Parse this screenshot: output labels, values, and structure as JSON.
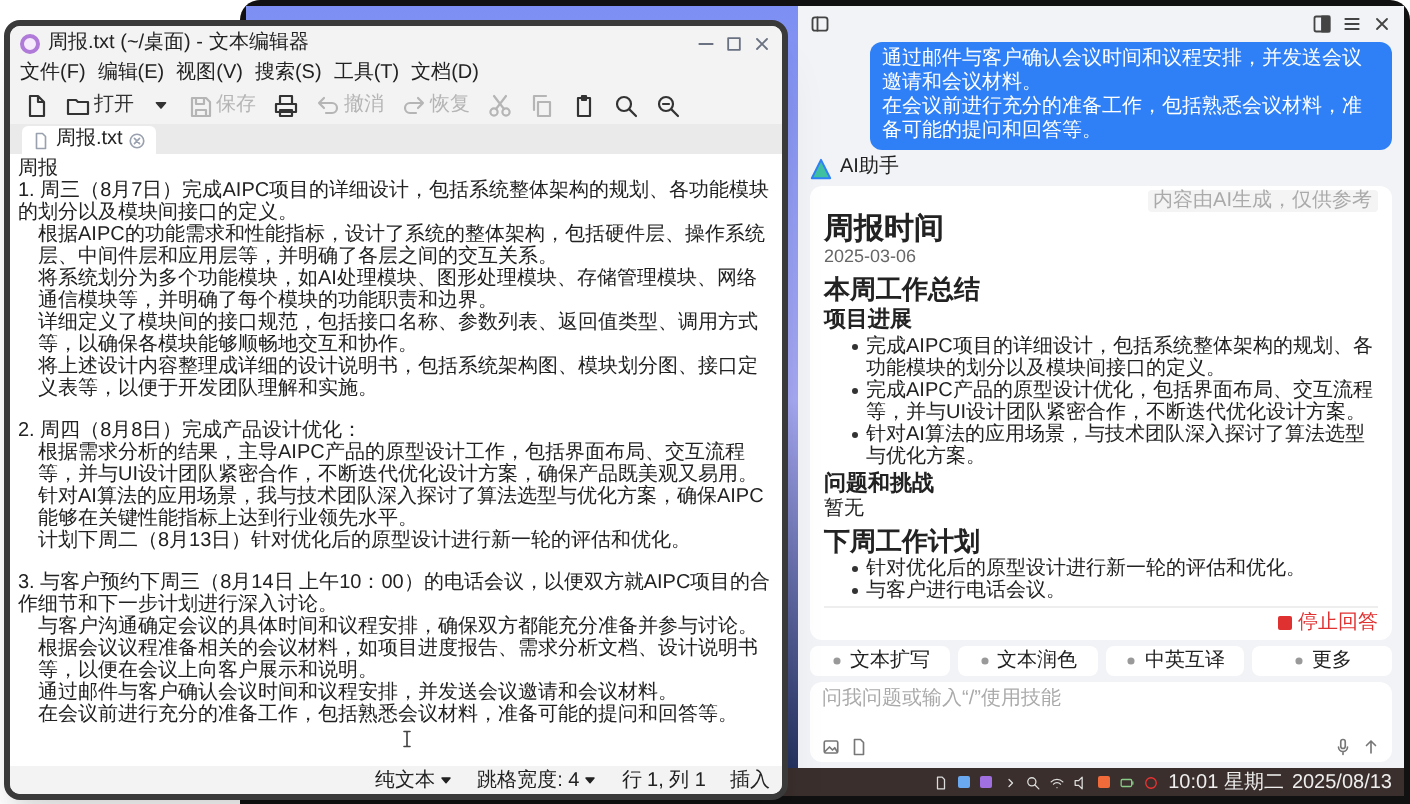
{
  "editor": {
    "title": "周报.txt (~/桌面) - 文本编辑器",
    "menu": [
      "文件(F)",
      "编辑(E)",
      "视图(V)",
      "搜索(S)",
      "工具(T)",
      "文档(D)"
    ],
    "toolbar": [
      {
        "kind": "new",
        "disabled": false
      },
      {
        "kind": "open",
        "label": "打开",
        "disabled": false
      },
      {
        "kind": "dropdown",
        "disabled": false
      },
      {
        "kind": "save",
        "label": "保存",
        "disabled": true
      },
      {
        "kind": "print",
        "disabled": false
      },
      {
        "kind": "undo",
        "label": "撤消",
        "disabled": true
      },
      {
        "kind": "redo",
        "label": "恢复",
        "disabled": true
      },
      {
        "kind": "cut",
        "disabled": true
      },
      {
        "kind": "copy",
        "disabled": true
      },
      {
        "kind": "paste",
        "disabled": false
      },
      {
        "kind": "search",
        "disabled": false
      },
      {
        "kind": "replace",
        "disabled": false
      }
    ],
    "tabs": [
      {
        "label": "周报.txt",
        "selected": true
      }
    ],
    "document": {
      "title": "周报",
      "sections": [
        {
          "heading": "1. 周三（8月7日）完成AIPC项目的详细设计，包括系统整体架构的规划、各功能模块的划分以及模块间接口的定义。",
          "lines": [
            "根据AIPC的功能需求和性能指标，设计了系统的整体架构，包括硬件层、操作系统层、中间件层和应用层等，并明确了各层之间的交互关系。",
            "将系统划分为多个功能模块，如AI处理模块、图形处理模块、存储管理模块、网络通信模块等，并明确了每个模块的功能职责和边界。",
            "详细定义了模块间的接口规范，包括接口名称、参数列表、返回值类型、调用方式等，以确保各模块能够顺畅地交互和协作。",
            "将上述设计内容整理成详细的设计说明书，包括系统架构图、模块划分图、接口定义表等，以便于开发团队理解和实施。"
          ]
        },
        {
          "heading": "2. 周四（8月8日）完成产品设计优化：",
          "lines": [
            "根据需求分析的结果，主导AIPC产品的原型设计工作，包括界面布局、交互流程等，并与UI设计团队紧密合作，不断迭代优化设计方案，确保产品既美观又易用。",
            "针对AI算法的应用场景，我与技术团队深入探讨了算法选型与优化方案，确保AIPC能够在关键性能指标上达到行业领先水平。",
            "计划下周二（8月13日）针对优化后的原型设计进行新一轮的评估和优化。"
          ]
        },
        {
          "heading": "3. 与客户预约下周三（8月14日 上午10：00）的电话会议，以便双方就AIPC项目的合作细节和下一步计划进行深入讨论。",
          "lines": [
            "与客户沟通确定会议的具体时间和议程安排，确保双方都能充分准备并参与讨论。",
            "根据会议议程准备相关的会议材料，如项目进度报告、需求分析文档、设计说明书等，以便在会议上向客户展示和说明。",
            "通过邮件与客户确认会议时间和议程安排，并发送会议邀请和会议材料。",
            "在会议前进行充分的准备工作，包括熟悉会议材料，准备可能的提问和回答等。"
          ]
        }
      ]
    },
    "status_bar": [
      {
        "kind": "dropdown",
        "label": "纯文本"
      },
      {
        "kind": "dropdown",
        "label": "跳格宽度: 4"
      },
      {
        "kind": "text",
        "label": "行 1, 列 1"
      },
      {
        "kind": "text",
        "label": "插入"
      }
    ]
  },
  "assistant": {
    "user_message": [
      "通过邮件与客户确认会议时间和议程安排，并发送会议邀请和会议材料。",
      "在会议前进行充分的准备工作，包括熟悉会议材料，准备可能的提问和回答等。"
    ],
    "name": "AI助手",
    "notice": "内容由AI生成，仅供参考",
    "report": {
      "title": "周报时间",
      "date": "2025-03-06",
      "sections": [
        {
          "heading": "本周工作总结",
          "subsections": [
            {
              "heading": "项目进展",
              "bullets": [
                "完成AIPC项目的详细设计，包括系统整体架构的规划、各功能模块的划分以及模块间接口的定义。",
                "完成AIPC产品的原型设计优化，包括界面布局、交互流程等，并与UI设计团队紧密合作，不断迭代优化设计方案。",
                "针对AI算法的应用场景，与技术团队深入探讨了算法选型与优化方案。"
              ]
            },
            {
              "heading": "问题和挑战",
              "text": "暂无"
            }
          ]
        },
        {
          "heading": "下周工作计划",
          "bullets": [
            "针对优化后的原型设计进行新一轮的评估和优化。",
            "与客户进行电话会议。"
          ]
        }
      ]
    },
    "stop_label": "停止回答",
    "chips": [
      "文本扩写",
      "文本润色",
      "中英互译",
      "更多"
    ],
    "placeholder": "问我问题或输入“/”使用技能"
  },
  "taskbar": {
    "time": "10:01 星期二",
    "date": "2025/08/13"
  }
}
